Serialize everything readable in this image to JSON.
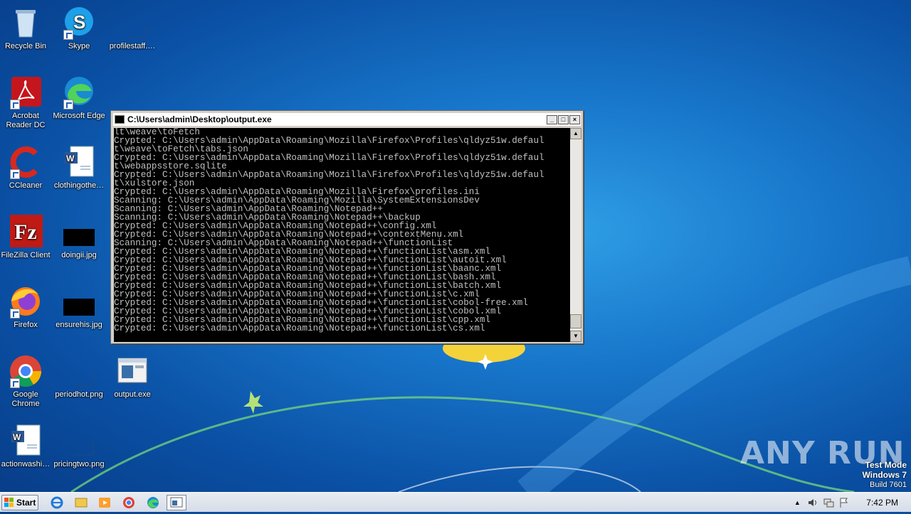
{
  "desktop": {
    "icons": [
      {
        "label": "Recycle Bin",
        "icon": "recycle-bin-icon"
      },
      {
        "label": "Skype",
        "icon": "skype-icon"
      },
      {
        "label": "profilestaff.…",
        "icon": "blank-file-icon"
      },
      {
        "label": "Acrobat Reader DC",
        "icon": "acrobat-icon"
      },
      {
        "label": "Microsoft Edge",
        "icon": "edge-icon"
      },
      {
        "label": "CCleaner",
        "icon": "ccleaner-icon"
      },
      {
        "label": "clothingothe…",
        "icon": "word-doc-icon"
      },
      {
        "label": "FileZilla Client",
        "icon": "filezilla-icon"
      },
      {
        "label": "doingii.jpg",
        "icon": "image-file-icon"
      },
      {
        "label": "Firefox",
        "icon": "firefox-icon"
      },
      {
        "label": "ensurehis.jpg",
        "icon": "image-file-icon"
      },
      {
        "label": "Google Chrome",
        "icon": "chrome-icon"
      },
      {
        "label": "periodhot.png",
        "icon": "blank-file-icon"
      },
      {
        "label": "output.exe",
        "icon": "exe-file-icon"
      },
      {
        "label": "actionwashi…",
        "icon": "word-doc-icon"
      },
      {
        "label": "pricingtwo.png",
        "icon": "blank-file-icon"
      }
    ]
  },
  "console_window": {
    "title": "C:\\Users\\admin\\Desktop\\output.exe",
    "lines": [
      "lt\\weave\\toFetch",
      "Crypted: C:\\Users\\admin\\AppData\\Roaming\\Mozilla\\Firefox\\Profiles\\qldyz51w.defaul",
      "t\\weave\\toFetch\\tabs.json",
      "Crypted: C:\\Users\\admin\\AppData\\Roaming\\Mozilla\\Firefox\\Profiles\\qldyz51w.defaul",
      "t\\webappsstore.sqlite",
      "Crypted: C:\\Users\\admin\\AppData\\Roaming\\Mozilla\\Firefox\\Profiles\\qldyz51w.defaul",
      "t\\xulstore.json",
      "Crypted: C:\\Users\\admin\\AppData\\Roaming\\Mozilla\\Firefox\\profiles.ini",
      "Scanning: C:\\Users\\admin\\AppData\\Roaming\\Mozilla\\SystemExtensionsDev",
      "Scanning: C:\\Users\\admin\\AppData\\Roaming\\Notepad++",
      "Scanning: C:\\Users\\admin\\AppData\\Roaming\\Notepad++\\backup",
      "Crypted: C:\\Users\\admin\\AppData\\Roaming\\Notepad++\\config.xml",
      "Crypted: C:\\Users\\admin\\AppData\\Roaming\\Notepad++\\contextMenu.xml",
      "Scanning: C:\\Users\\admin\\AppData\\Roaming\\Notepad++\\functionList",
      "Crypted: C:\\Users\\admin\\AppData\\Roaming\\Notepad++\\functionList\\asm.xml",
      "Crypted: C:\\Users\\admin\\AppData\\Roaming\\Notepad++\\functionList\\autoit.xml",
      "Crypted: C:\\Users\\admin\\AppData\\Roaming\\Notepad++\\functionList\\baanc.xml",
      "Crypted: C:\\Users\\admin\\AppData\\Roaming\\Notepad++\\functionList\\bash.xml",
      "Crypted: C:\\Users\\admin\\AppData\\Roaming\\Notepad++\\functionList\\batch.xml",
      "Crypted: C:\\Users\\admin\\AppData\\Roaming\\Notepad++\\functionList\\c.xml",
      "Crypted: C:\\Users\\admin\\AppData\\Roaming\\Notepad++\\functionList\\cobol-free.xml",
      "Crypted: C:\\Users\\admin\\AppData\\Roaming\\Notepad++\\functionList\\cobol.xml",
      "Crypted: C:\\Users\\admin\\AppData\\Roaming\\Notepad++\\functionList\\cpp.xml",
      "Crypted: C:\\Users\\admin\\AppData\\Roaming\\Notepad++\\functionList\\cs.xml"
    ]
  },
  "taskbar": {
    "start_label": "Start",
    "pinned": [
      "ie-icon",
      "explorer-icon",
      "media-player-icon",
      "chrome-icon",
      "edge-icon",
      "console-icon"
    ],
    "clock": "7:42 PM"
  },
  "watermark": {
    "mode": "Test Mode",
    "os": "Windows 7",
    "build": "Build 7601",
    "brand": "ANY RUN"
  },
  "colors": {
    "console_bg": "#000000",
    "console_fg": "#c0c0c0",
    "desktop_blue": "#1775c9"
  }
}
